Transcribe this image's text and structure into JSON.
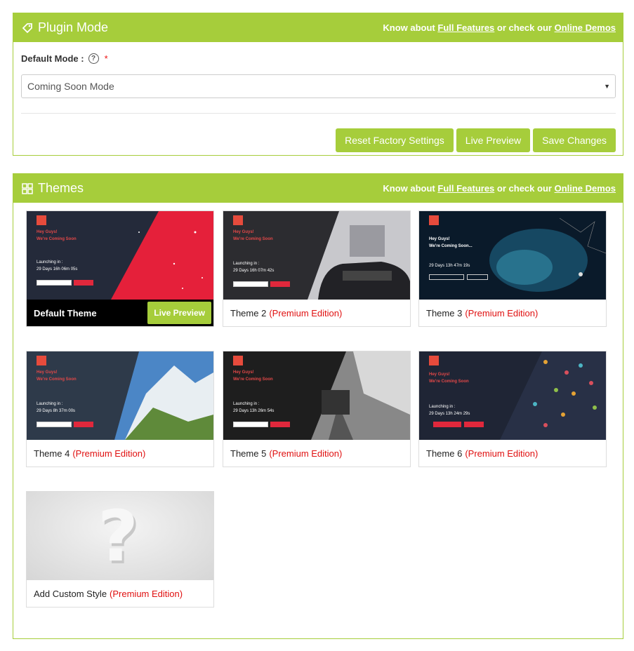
{
  "plugin_mode": {
    "title": "Plugin Mode",
    "header_links": {
      "prefix": "Know about",
      "features": "Full Features",
      "middle": "or check our",
      "demos": "Online Demos"
    },
    "field_label": "Default Mode :",
    "help": "?",
    "required": "*",
    "selected_mode": "Coming Soon Mode",
    "buttons": {
      "reset": "Reset Factory Settings",
      "preview": "Live Preview",
      "save": "Save Changes"
    }
  },
  "themes": {
    "title": "Themes",
    "header_links": {
      "prefix": "Know about",
      "features": "Full Features",
      "middle": "or check our",
      "demos": "Online Demos"
    },
    "live_preview": "Live Preview",
    "premium_tag": "(Premium Edition)",
    "items": [
      {
        "name": "Default Theme"
      },
      {
        "name": "Theme 2"
      },
      {
        "name": "Theme 3"
      },
      {
        "name": "Theme 4"
      },
      {
        "name": "Theme 5"
      },
      {
        "name": "Theme 6"
      },
      {
        "name": "Add Custom Style"
      }
    ],
    "thumbs": {
      "t1": {
        "l1": "Hey Guys!",
        "l2": "We're Coming Soon",
        "l3": "Launching in :",
        "l4": "29 Days 16h 06m 05s"
      },
      "t2": {
        "l1": "Hey Guys!",
        "l2": "We're Coming Soon",
        "l3": "Launching in :",
        "l4": "29 Days 16h 07m 42s"
      },
      "t3": {
        "l1": "Hey Guys!",
        "l2": "We're Coming Soon...",
        "l4": "29 Days 13h 47m 19s"
      },
      "t4": {
        "l1": "Hey Guys!",
        "l2": "We're Coming Soon",
        "l3": "Launching in :",
        "l4": "29 Days 8h 37m 00s"
      },
      "t5": {
        "l1": "Hey Guys!",
        "l2": "We're Coming Soon",
        "l3": "Launching in :",
        "l4": "29 Days 13h 26m 54s"
      },
      "t6": {
        "l1": "Hey Guys!",
        "l2": "We're Coming Soon",
        "l3": "Launching in :",
        "l4": "29 Days 13h 24m 29s"
      }
    }
  },
  "colors": {
    "accent": "#a6cd3b",
    "premium": "#e01010",
    "brand_red": "#e64b3c"
  }
}
